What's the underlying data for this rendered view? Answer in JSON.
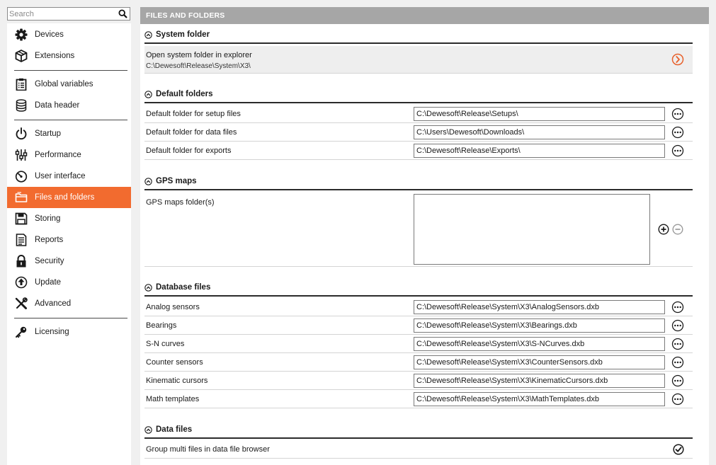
{
  "search": {
    "placeholder": "Search",
    "icon": "search-icon"
  },
  "sidebar": {
    "items": [
      {
        "label": "Devices",
        "icon": "gear-icon"
      },
      {
        "label": "Extensions",
        "icon": "cube-icon"
      },
      {
        "label": "Global variables",
        "icon": "clipboard-icon"
      },
      {
        "label": "Data header",
        "icon": "database-icon"
      },
      {
        "label": "Startup",
        "icon": "power-icon"
      },
      {
        "label": "Performance",
        "icon": "sliders-icon"
      },
      {
        "label": "User interface",
        "icon": "gauge-icon"
      },
      {
        "label": "Files and folders",
        "icon": "folder-icon",
        "active": true
      },
      {
        "label": "Storing",
        "icon": "floppy-icon"
      },
      {
        "label": "Reports",
        "icon": "report-icon"
      },
      {
        "label": "Security",
        "icon": "lock-icon"
      },
      {
        "label": "Update",
        "icon": "update-icon"
      },
      {
        "label": "Advanced",
        "icon": "tools-icon"
      },
      {
        "label": "Licensing",
        "icon": "key-icon"
      }
    ]
  },
  "header": {
    "title": "FILES AND FOLDERS"
  },
  "sections": {
    "system_folder": {
      "title": "System folder",
      "open_label": "Open system folder in explorer",
      "path": "C:\\Dewesoft\\Release\\System\\X3\\"
    },
    "default_folders": {
      "title": "Default folders",
      "rows": [
        {
          "label": "Default folder for setup files",
          "value": "C:\\Dewesoft\\Release\\Setups\\"
        },
        {
          "label": "Default folder for data files",
          "value": "C:\\Users\\Dewesoft\\Downloads\\"
        },
        {
          "label": "Default folder for exports",
          "value": "C:\\Dewesoft\\Release\\Exports\\"
        }
      ]
    },
    "gps_maps": {
      "title": "GPS maps",
      "label": "GPS maps folder(s)"
    },
    "database_files": {
      "title": "Database files",
      "rows": [
        {
          "label": "Analog sensors",
          "value": "C:\\Dewesoft\\Release\\System\\X3\\AnalogSensors.dxb"
        },
        {
          "label": "Bearings",
          "value": "C:\\Dewesoft\\Release\\System\\X3\\Bearings.dxb"
        },
        {
          "label": "S-N curves",
          "value": "C:\\Dewesoft\\Release\\System\\X3\\S-NCurves.dxb"
        },
        {
          "label": "Counter sensors",
          "value": "C:\\Dewesoft\\Release\\System\\X3\\CounterSensors.dxb"
        },
        {
          "label": "Kinematic cursors",
          "value": "C:\\Dewesoft\\Release\\System\\X3\\KinematicCursors.dxb"
        },
        {
          "label": "Math templates",
          "value": "C:\\Dewesoft\\Release\\System\\X3\\MathTemplates.dxb"
        }
      ]
    },
    "data_files": {
      "title": "Data files",
      "group_label": "Group multi files in data file browser",
      "group_checked": true
    }
  },
  "colors": {
    "accent": "#f26b2f",
    "header_bg": "#a6a6a6",
    "open_arrow": "#e8612c"
  }
}
